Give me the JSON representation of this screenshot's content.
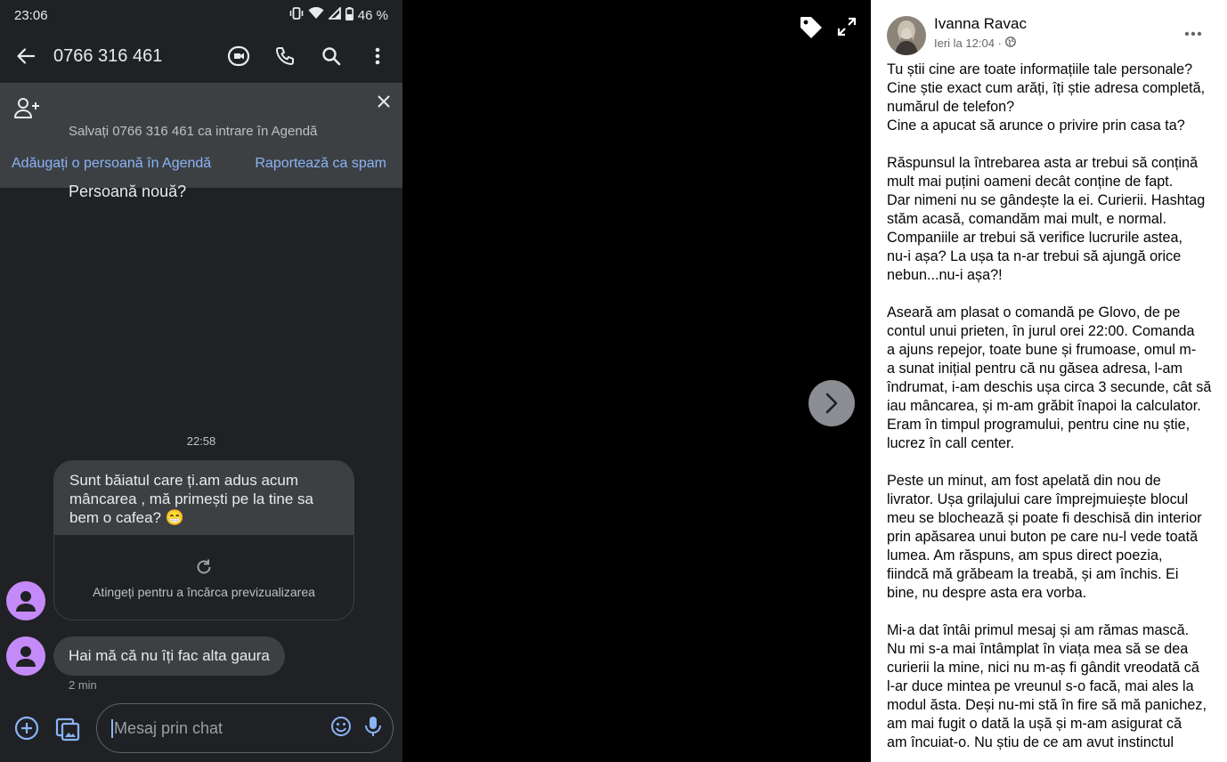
{
  "phone": {
    "status": {
      "time": "23:06",
      "battery": "46 %"
    },
    "appbar": {
      "title": "0766 316 461"
    },
    "banner": {
      "title": "Persoană nouă?",
      "subtitle": "Salvați 0766 316 461 ca intrare în Agendă",
      "add_link": "Adăugați o persoană în Agendă",
      "spam_link": "Raportează ca spam"
    },
    "thread": {
      "time_label": "22:58",
      "message1": "Sunt băiatul care ți.am adus acum mâncarea , mă primești pe la tine sa bem o cafea? 😁",
      "preview_label": "Atingeți pentru a încărca previzualizarea",
      "message2": "Hai mă că nu îți fac alta gaura",
      "message2_age": "2 min"
    },
    "composer": {
      "placeholder": "Mesaj prin chat"
    }
  },
  "post": {
    "author": "Ivanna Ravac",
    "meta": "Ieri la 12:04 ·",
    "paragraphs": [
      [
        "Tu știi cine are toate informațiile tale personale?",
        "Cine știe exact cum arăți, îți știe adresa completă,",
        "numărul de telefon?",
        "Cine a apucat să arunce o privire prin casa ta?"
      ],
      [
        "Răspunsul la întrebarea asta ar trebui să conțină",
        "mult mai puțini oameni decât conține de fapt.",
        "Dar nimeni nu se gândește la ei. Curierii. Hashtag",
        "stăm acasă, comandăm mai mult, e normal.",
        "Companiile ar trebui să verifice lucrurile astea,",
        "nu-i așa? La ușa ta n-ar trebui să ajungă orice",
        "nebun...nu-i așa?!"
      ],
      [
        "Aseară am plasat o comandă pe Glovo, de pe",
        "contul unui prieten, în jurul orei 22:00. Comanda",
        "a ajuns repejor, toate bune și frumoase, omul m-",
        "a sunat inițial pentru că nu găsea adresa, l-am",
        "îndrumat, i-am deschis ușa circa 3 secunde, cât să",
        "iau mâncarea, și m-am grăbit înapoi la calculator.",
        "Eram în timpul programului, pentru cine nu știe,",
        "lucrez în call center."
      ],
      [
        "Peste un minut, am fost apelată din nou de",
        "livrator. Ușa grilajului care împrejmuiește blocul",
        "meu se blochează și poate fi deschisă din interior",
        "prin apăsarea unui buton pe care nu-l vede toată",
        "lumea. Am răspuns, am spus direct poezia,",
        "fiindcă mă grăbeam la treabă, și am închis. Ei",
        "bine, nu despre asta era vorba."
      ],
      [
        "Mi-a dat întâi primul mesaj și am rămas mască.",
        "Nu mi s-a mai întâmplat în viața mea să se dea",
        "curierii la mine, nici nu m-aș fi gândit vreodată că",
        "l-ar duce mintea pe vreunul s-o facă, mai ales la",
        "modul ăsta. Deși nu-mi stă în fire să mă panichez,",
        "am mai fugit o dată la ușă și m-am asigurat că",
        "am încuiat-o. Nu știu de ce am avut instinctul"
      ]
    ]
  },
  "colors": {
    "phone_bg": "#202124",
    "banner_bg": "#3c4043",
    "link": "#8ab4f8",
    "avatar": "#c58af9",
    "viewer_bg": "#000000",
    "post_bg": "#ffffff"
  }
}
